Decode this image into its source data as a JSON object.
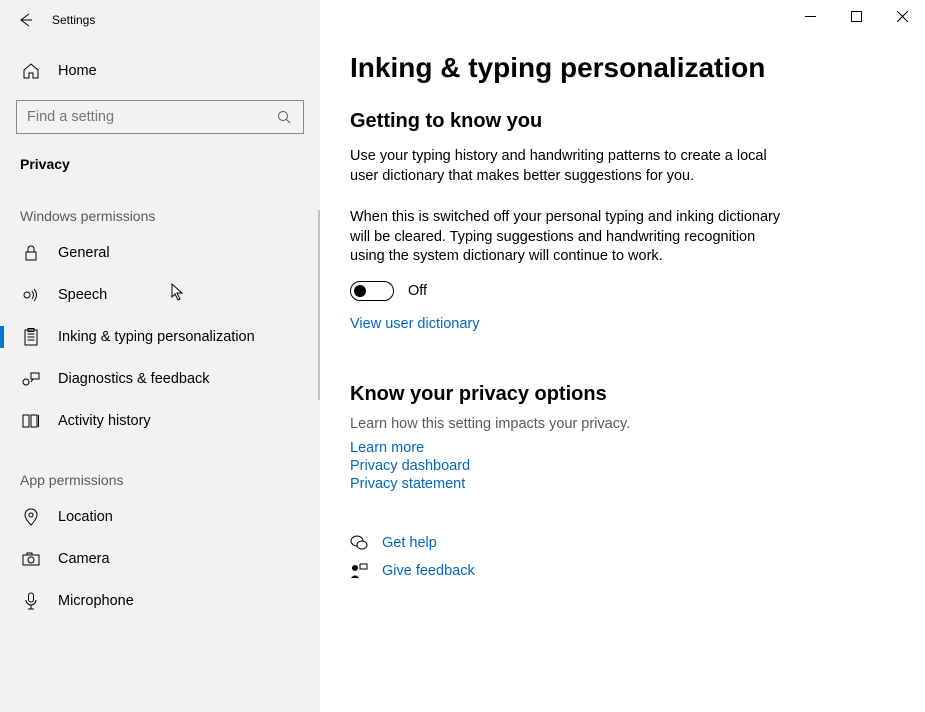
{
  "app_title": "Settings",
  "sidebar": {
    "home": "Home",
    "search_placeholder": "Find a setting",
    "category": "Privacy",
    "sections": {
      "windows_permissions": "Windows permissions",
      "app_permissions": "App permissions"
    },
    "items": {
      "general": "General",
      "speech": "Speech",
      "inking": "Inking & typing personalization",
      "diagnostics": "Diagnostics & feedback",
      "activity": "Activity history",
      "location": "Location",
      "camera": "Camera",
      "microphone": "Microphone"
    }
  },
  "main": {
    "title": "Inking & typing personalization",
    "s1": {
      "heading": "Getting to know you",
      "p1": "Use your typing history and handwriting patterns to create a local user dictionary that makes better suggestions for you.",
      "p2": "When this is switched off your personal typing and inking dictionary will be cleared. Typing suggestions and handwriting recognition using the system dictionary will continue to work.",
      "toggle_state": "Off",
      "link": "View user dictionary"
    },
    "s2": {
      "heading": "Know your privacy options",
      "sub": "Learn how this setting impacts your privacy.",
      "links": {
        "learn": "Learn more",
        "dashboard": "Privacy dashboard",
        "statement": "Privacy statement"
      }
    },
    "help": {
      "get_help": "Get help",
      "feedback": "Give feedback"
    }
  }
}
